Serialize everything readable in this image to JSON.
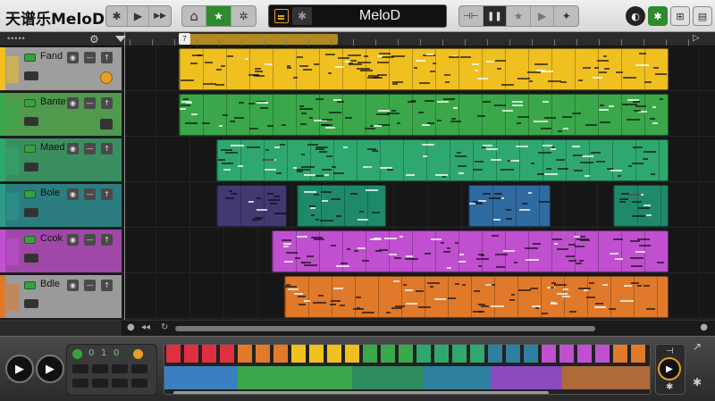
{
  "app": {
    "title": "天谱乐MeloD",
    "lcd_name": "MeloD"
  },
  "toolbar": {
    "left_group": [
      {
        "icon": "snowflake-icon",
        "glyph": "✱"
      },
      {
        "icon": "play-icon",
        "glyph": "▶"
      },
      {
        "icon": "fast-forward-icon",
        "glyph": "▶▶"
      }
    ],
    "mid_group": [
      {
        "icon": "home-icon",
        "glyph": "⌂"
      },
      {
        "icon": "star-icon",
        "glyph": "★"
      },
      {
        "icon": "plugin-icon",
        "glyph": "✲"
      }
    ],
    "right_group": [
      {
        "icon": "split-icon",
        "glyph": "⊣⊢"
      },
      {
        "icon": "pause-icon",
        "glyph": "❚❚"
      },
      {
        "icon": "star-outline-icon",
        "glyph": "★"
      },
      {
        "icon": "play-icon",
        "glyph": "▶"
      },
      {
        "icon": "sparkle-icon",
        "glyph": "✦"
      }
    ],
    "lcd_icon": "list-icon",
    "lcd_badge": "✱",
    "far_right": [
      {
        "icon": "tuner-icon",
        "glyph": "◐"
      },
      {
        "icon": "snowflake-icon",
        "glyph": "✱"
      },
      {
        "icon": "mixer-icon",
        "glyph": "⊞"
      },
      {
        "icon": "library-icon",
        "glyph": "▤"
      }
    ]
  },
  "ruler": {
    "marker_label": "7",
    "dots": "•••••"
  },
  "tracks": [
    {
      "name": "Fand",
      "color": "#f0c020",
      "header_color": "#9e9e9e"
    },
    {
      "name": "Bante",
      "color": "#3aa84a",
      "header_color": "#4f9a4c"
    },
    {
      "name": "Maed",
      "color": "#2fa870",
      "header_color": "#3a8f60"
    },
    {
      "name": "Bole",
      "color": "#2e9a8a",
      "header_color": "#2c7d80"
    },
    {
      "name": "Ccok",
      "color": "#c050d0",
      "header_color": "#a048a8"
    },
    {
      "name": "Bdle",
      "color": "#e07a2a",
      "header_color": "#9a9a9a"
    }
  ],
  "colors": {
    "yellow": "#f0c020",
    "green": "#3aa84a",
    "teal": "#2fa870",
    "blue": "#2f7fa0",
    "purple": "#c050d0",
    "orange": "#e07a2a",
    "accent_green": "#2e8b2e"
  },
  "bottom": {
    "play_glyph": "▶",
    "led_values": [
      "0",
      "1",
      "0"
    ]
  }
}
